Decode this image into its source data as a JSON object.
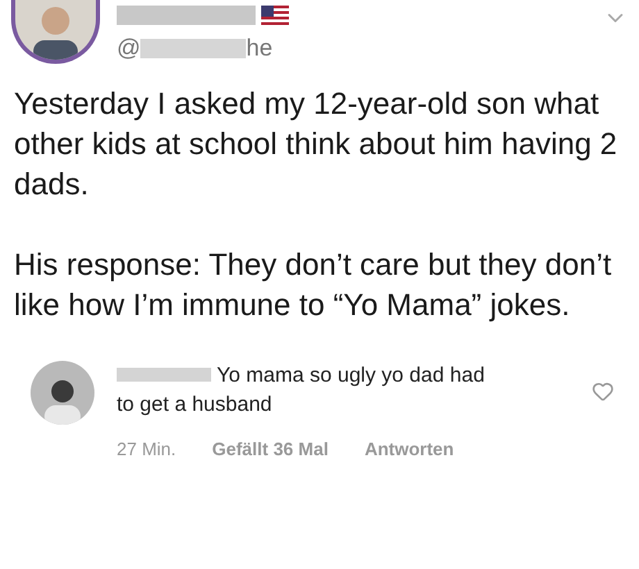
{
  "post": {
    "handle_start": "@",
    "handle_end": "he",
    "paragraphs": [
      "Yesterday I asked my 12-year-old son what other kids at school think about him having 2 dads.",
      "His response: They don’t care but they don’t like how I’m immune to “Yo Mama” jokes."
    ]
  },
  "comment": {
    "text_lines": [
      "Yo mama so ugly yo dad had",
      "to get a husband"
    ],
    "time": "27 Min.",
    "likes": "Gefällt 36 Mal",
    "reply": "Antworten",
    "liked": false
  }
}
